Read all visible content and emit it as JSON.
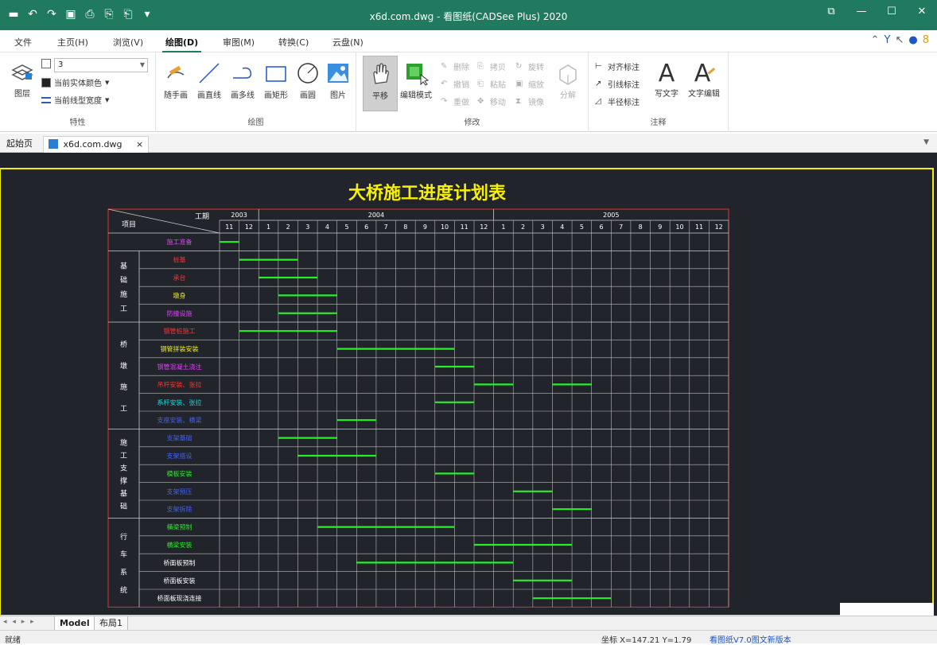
{
  "titlebar": {
    "title": "x6d.com.dwg - 看图纸(CADSee Plus) 2020",
    "qat_icons": [
      "folder-icon",
      "undo-icon",
      "redo-icon",
      "save-icon",
      "print-icon",
      "print-settings-icon",
      "export-icon",
      "customize-icon"
    ],
    "win_icons": [
      "restore-icon",
      "minimize-icon",
      "maximize-icon",
      "close-icon"
    ],
    "win_glyphs": [
      "⧉",
      "—",
      "☐",
      "✕"
    ],
    "qat_glyphs": [
      "▬",
      "↶",
      "↷",
      "▣",
      "⎙",
      "⎘",
      "⎗",
      "▾"
    ],
    "bg": "#1f7a5f"
  },
  "ribbon_tabs": [
    {
      "label": "文件"
    },
    {
      "label": "主页(H)"
    },
    {
      "label": "浏览(V)"
    },
    {
      "label": "绘图(D)",
      "active": true
    },
    {
      "label": "审图(M)"
    },
    {
      "label": "转换(C)"
    },
    {
      "label": "云盘(N)"
    }
  ],
  "ribbon": {
    "props": {
      "layer_btn": "图层",
      "layer_value": "3",
      "color_label": "当前实体颜色",
      "linewidth_label": "当前线型宽度",
      "group": "特性"
    },
    "draw": {
      "tools": [
        "随手画",
        "画直线",
        "画多线",
        "画矩形",
        "画圆",
        "图片"
      ],
      "group": "绘图"
    },
    "modify": {
      "pan": "平移",
      "edit_mode": "编辑模式",
      "small": [
        "删除",
        "拷贝",
        "旋转",
        "撤销",
        "粘贴",
        "缩放",
        "重做",
        "移动",
        "镜像"
      ],
      "explode": "分解",
      "group": "修改"
    },
    "annotate": {
      "small": [
        "对齐标注",
        "引线标注",
        "半径标注"
      ],
      "write_text": "写文字",
      "edit_text": "文字编辑",
      "group": "注释"
    }
  },
  "doctabs": {
    "start": "起始页",
    "file": "x6d.com.dwg",
    "close": "×"
  },
  "drawing": {
    "title": "大桥施工进度计划表",
    "header_project": "项目",
    "header_period": "工期",
    "years": [
      "2003",
      "2004",
      "2005"
    ],
    "months": [
      "11",
      "12",
      "1",
      "2",
      "3",
      "4",
      "5",
      "6",
      "7",
      "8",
      "9",
      "10",
      "11",
      "12",
      "1",
      "2",
      "3",
      "4",
      "5",
      "6",
      "7",
      "8",
      "9",
      "10",
      "11",
      "12"
    ],
    "groups": [
      {
        "label": "",
        "rows": 1
      },
      {
        "label": "基础施工",
        "rows": 4
      },
      {
        "label": "桥墩施工",
        "rows": 6
      },
      {
        "label": "施工支撑基础",
        "rows": 5
      },
      {
        "label": "行车系统",
        "rows": 5
      }
    ],
    "tasks": [
      {
        "name": "施工准备",
        "color": "#e040fb",
        "start": 0,
        "end": 1
      },
      {
        "name": "桩基",
        "color": "#ff3030",
        "start": 1,
        "end": 4
      },
      {
        "name": "承台",
        "color": "#ff3030",
        "start": 2,
        "end": 5
      },
      {
        "name": "墩身",
        "color": "#f7f000",
        "start": 3,
        "end": 6
      },
      {
        "name": "防撞设施",
        "color": "#e040fb",
        "start": 3,
        "end": 6
      },
      {
        "name": "钢管桩施工",
        "color": "#ff3030",
        "start": 1,
        "end": 6
      },
      {
        "name": "钢管拼装安装",
        "color": "#f7f000",
        "start": 6,
        "end": 12
      },
      {
        "name": "钢管混凝土浇注",
        "color": "#e040fb",
        "start": 11,
        "end": 13
      },
      {
        "name": "吊杆安装、张拉",
        "color": "#ff3030",
        "start": 13,
        "end": 15,
        "start2": 17,
        "end2": 19
      },
      {
        "name": "系杆安装、张拉",
        "color": "#00e5e5",
        "start": 11,
        "end": 13
      },
      {
        "name": "支座安装、横梁",
        "color": "#4060ff",
        "start": 6,
        "end": 8
      },
      {
        "name": "支架基础",
        "color": "#4060ff",
        "start": 3,
        "end": 6
      },
      {
        "name": "支架搭设",
        "color": "#4060ff",
        "start": 4,
        "end": 8
      },
      {
        "name": "模板安装",
        "color": "#2ee82e",
        "start": 11,
        "end": 13
      },
      {
        "name": "支架预压",
        "color": "#4060ff",
        "start": 15,
        "end": 17
      },
      {
        "name": "支架拆除",
        "color": "#4060ff",
        "start": 17,
        "end": 19
      },
      {
        "name": "横梁预制",
        "color": "#2ee82e",
        "start": 5,
        "end": 12
      },
      {
        "name": "横梁安装",
        "color": "#2ee82e",
        "start": 13,
        "end": 18
      },
      {
        "name": "桥面板预制",
        "color": "#ffffff",
        "start": 7,
        "end": 15
      },
      {
        "name": "桥面板安装",
        "color": "#ffffff",
        "start": 15,
        "end": 18
      },
      {
        "name": "桥面板现浇连接",
        "color": "#ffffff",
        "start": 16,
        "end": 20
      }
    ],
    "bar_color": "#29ef29",
    "frame_color": "#f7f000",
    "table_color": "#c03030",
    "canvas_bg": "#21252b"
  },
  "layouttabs": {
    "nav": "◂ ◂ ▸ ▸",
    "model": "Model",
    "layout1": "布局1"
  },
  "statusbar": {
    "ready": "就绪",
    "coords": "坐标 X=147.21 Y=1.79",
    "version": "看图纸V7.0图文新版本"
  }
}
